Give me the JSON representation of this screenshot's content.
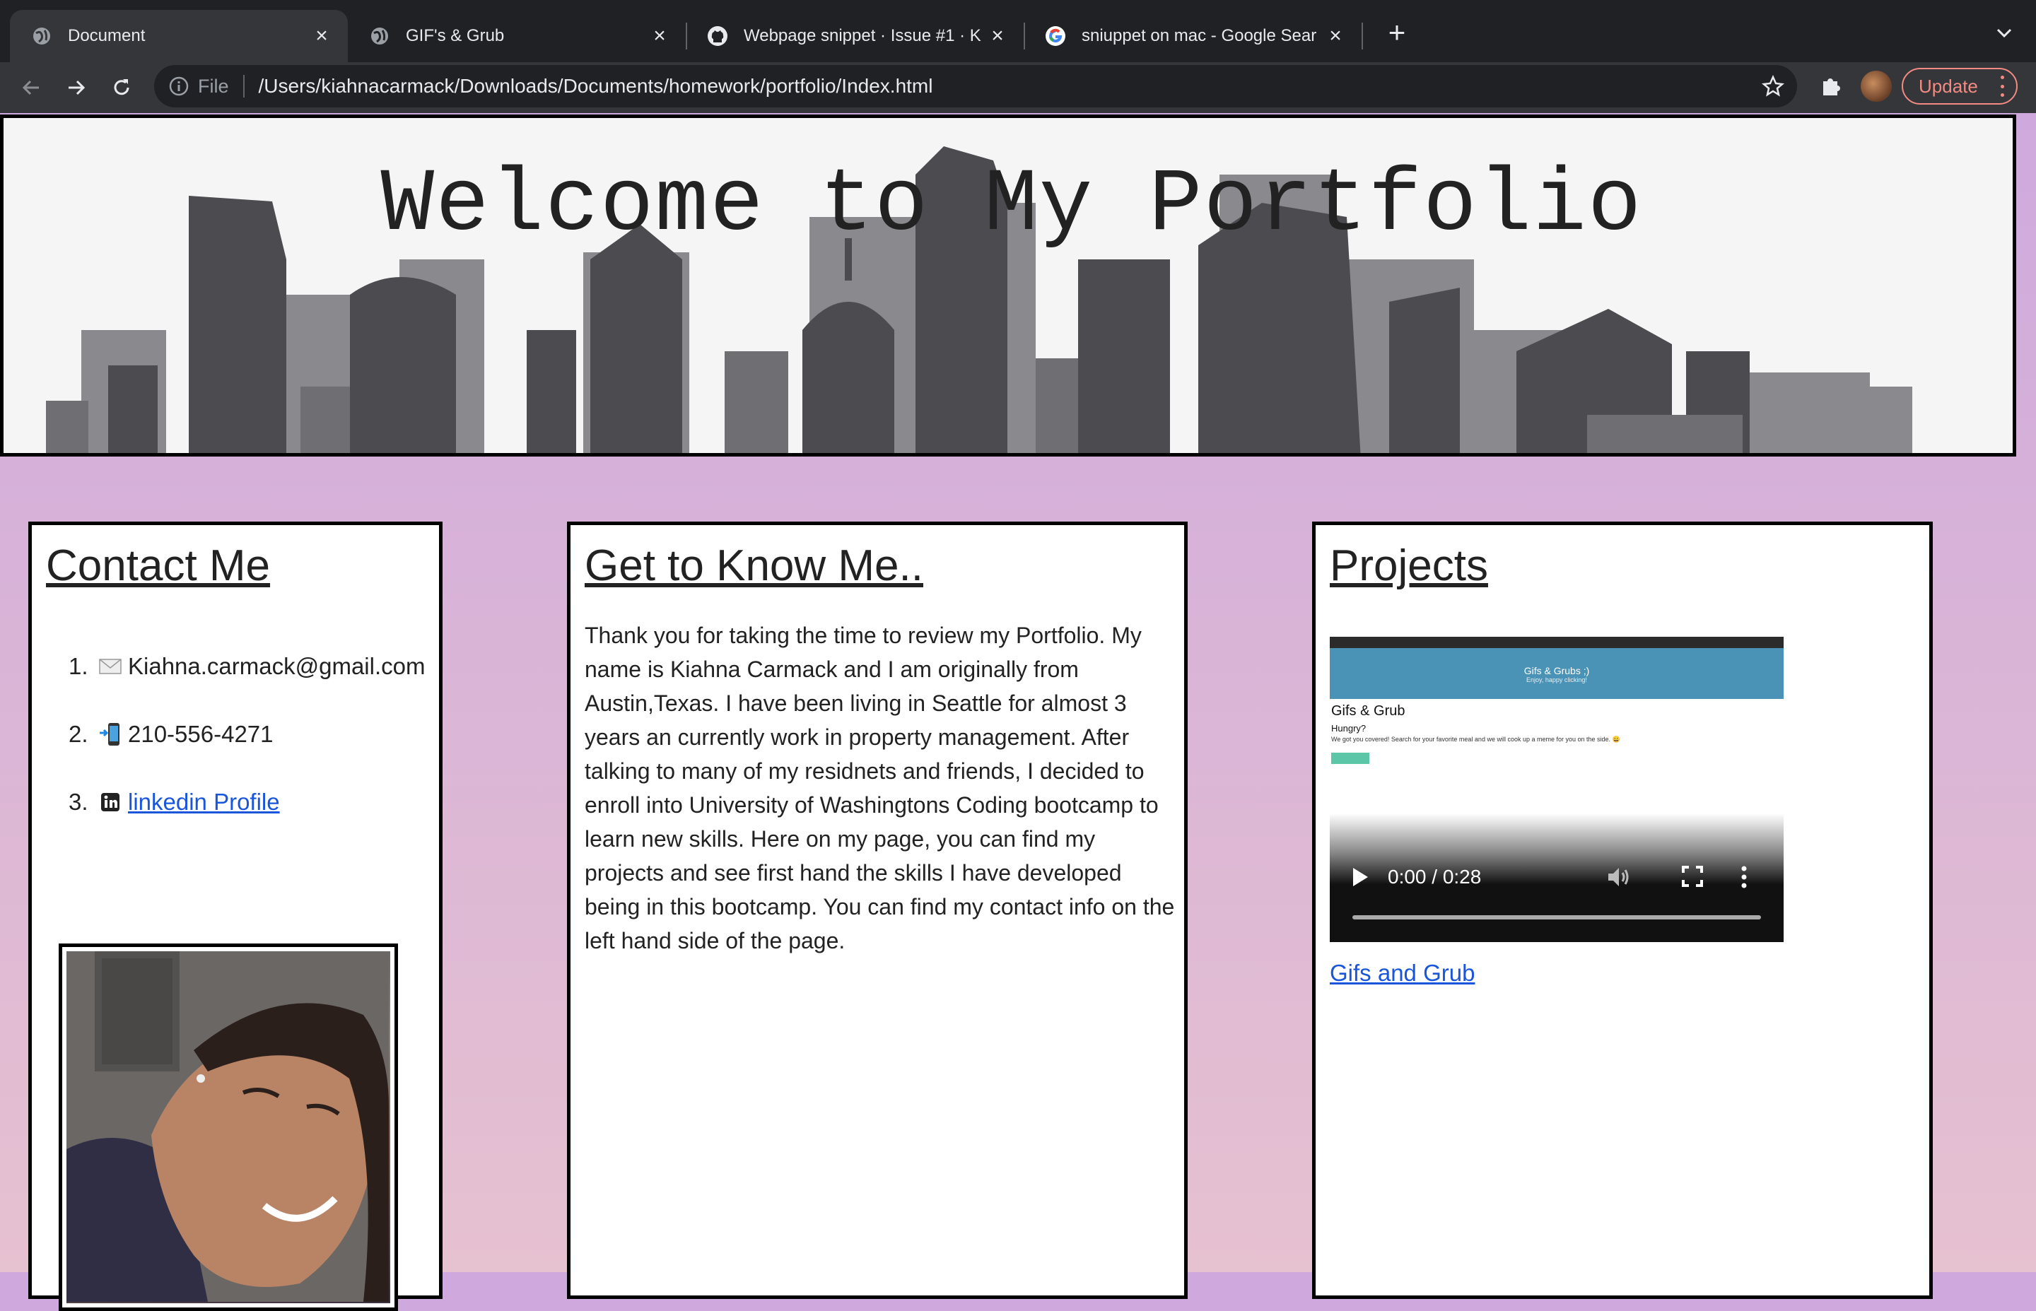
{
  "browser": {
    "tabs": [
      {
        "title": "Document",
        "icon": "globe-icon",
        "active": true
      },
      {
        "title": "GIF's & Grub",
        "icon": "globe-icon",
        "active": false
      },
      {
        "title": "Webpage snippet · Issue #1 · K",
        "icon": "github-icon",
        "active": false
      },
      {
        "title": "sniuppet on mac - Google Sear",
        "icon": "google-icon",
        "active": false
      }
    ],
    "omnibox": {
      "scheme_label": "File",
      "url": "/Users/kiahnacarmack/Downloads/Documents/homework/portfolio/Index.html"
    },
    "update_label": "Update"
  },
  "hero": {
    "title": "Welcome to My Portfolio"
  },
  "contact": {
    "heading": "Contact Me",
    "items": [
      {
        "num": "1.",
        "icon": "envelope-icon",
        "text": "Kiahna.carmack@gmail.com",
        "is_link": false
      },
      {
        "num": "2.",
        "icon": "phone-icon",
        "text": "210-556-4271",
        "is_link": false
      },
      {
        "num": "3.",
        "icon": "linkedin-icon",
        "text": "linkedin Profile",
        "is_link": true
      }
    ]
  },
  "about": {
    "heading": "Get to Know Me..",
    "body": "Thank you for taking the time to review my Portfolio. My name is Kiahna Carmack and I am originally from Austin,Texas. I have been living in Seattle for almost 3 years an currently work in property management. After talking to many of my residnets and friends, I decided to enroll into University of Washingtons Coding bootcamp to learn new skills. Here on my page, you can find my projects and see first hand the skills I have developed being in this bootcamp. You can find my contact info on the left hand side of the page."
  },
  "projects": {
    "heading": "Projects",
    "video": {
      "time": "0:00 / 0:28",
      "progress": 0,
      "frame": {
        "banner_title": "Gifs & Grubs ;)",
        "banner_subtitle": "Enjoy, happy clicking!",
        "page_title": "Gifs & Grub",
        "hungry": "Hungry?",
        "text": "We got you covered! Search for your favorite meal and we will cook up a meme for you on the side. 😀"
      }
    },
    "link_label": "Gifs and Grub"
  },
  "colors": {
    "page_top": "#cfa9dd",
    "page_bottom": "#e6c1d0",
    "link": "#1a56db",
    "chrome_dark": "#202124",
    "chrome_toolbar": "#35363a",
    "update_accent": "#f28b82"
  }
}
